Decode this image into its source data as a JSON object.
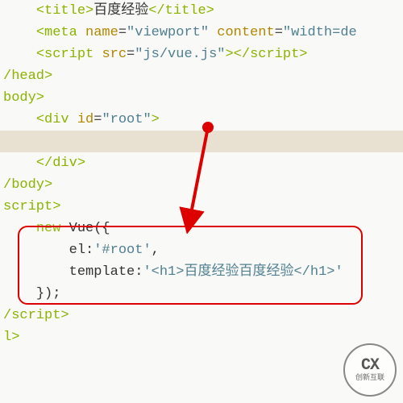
{
  "code": {
    "l1_title_open": "<title>",
    "l1_title_text": "百度经验",
    "l1_title_close": "</title>",
    "l2_meta_open": "<meta",
    "l2_name_attr": "name",
    "l2_name_val": "\"viewport\"",
    "l2_content_attr": "content",
    "l2_content_val": "\"width=de",
    "l3_script_open": "<script",
    "l3_src_attr": "src",
    "l3_src_val": "\"js/vue.js\"",
    "l3_script_mid": ">",
    "l3_script_close": "</script",
    "l3_gt": ">",
    "l4_head_close": "/head>",
    "l5_body_open": "body>",
    "l6_div_open": "<div",
    "l6_id_attr": "id",
    "l6_id_val": "\"root\"",
    "l6_gt": ">",
    "l8_div_close": "</div>",
    "l9_body_close": "/body>",
    "l10_script_open": "script>",
    "l11_new": "new",
    "l11_vue": "Vue({",
    "l12_el_key": "el:",
    "l12_el_val": "'#root'",
    "l12_comma": ",",
    "l13_tmpl_key": "template:",
    "l13_tmpl_val": "'<h1>百度经验百度经验</h1>'",
    "l14_close": "});",
    "l15_script_close": "/script>",
    "l16_close": "l>"
  },
  "watermark": {
    "big": "CX",
    "small": "创新互联"
  }
}
